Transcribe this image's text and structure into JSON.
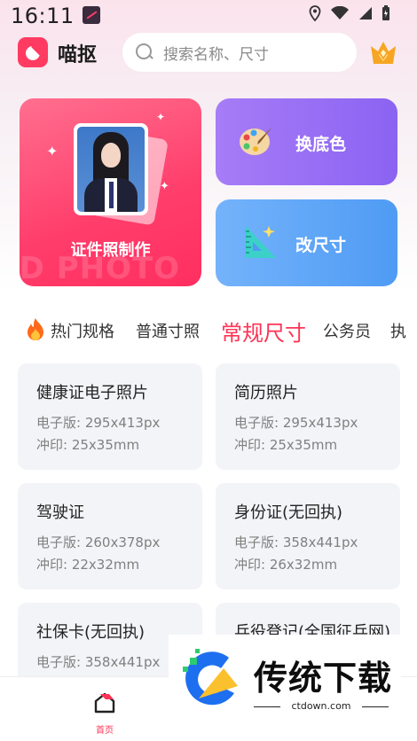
{
  "status_bar": {
    "time": "16:11"
  },
  "header": {
    "app_name": "喵抠",
    "search_placeholder": "搜索名称、尺寸"
  },
  "features": {
    "id_photo": {
      "label": "证件照制作",
      "watermark": "ID PHOTO"
    },
    "change_bg": {
      "label": "换底色"
    },
    "resize": {
      "label": "改尺寸"
    }
  },
  "tabs": [
    {
      "label": "热门规格"
    },
    {
      "label": "普通寸照"
    },
    {
      "label": "常规尺寸",
      "active": true
    },
    {
      "label": "公务员"
    },
    {
      "label": "执"
    }
  ],
  "specs": [
    {
      "title": "健康证电子照片",
      "digital": "电子版: 295x413px",
      "print": "冲印: 25x35mm"
    },
    {
      "title": "简历照片",
      "digital": "电子版: 295x413px",
      "print": "冲印: 25x35mm"
    },
    {
      "title": "驾驶证",
      "digital": "电子版: 260x378px",
      "print": "冲印: 22x32mm"
    },
    {
      "title": "身份证(无回执)",
      "digital": "电子版: 358x441px",
      "print": "冲印: 26x32mm"
    },
    {
      "title": "社保卡(无回执)",
      "digital": "电子版: 358x441px",
      "print": ""
    },
    {
      "title": "兵役登记(全国征兵网)",
      "digital": "",
      "print": ""
    }
  ],
  "bottom_nav": {
    "home_label": "首页"
  },
  "overlay": {
    "title": "传统下载",
    "url": "ctdown.com"
  },
  "colors": {
    "accent": "#ff3355",
    "id_card": "#ff3d6b",
    "bg_card": "#9a70f5",
    "resize_card": "#5fa6f7"
  }
}
